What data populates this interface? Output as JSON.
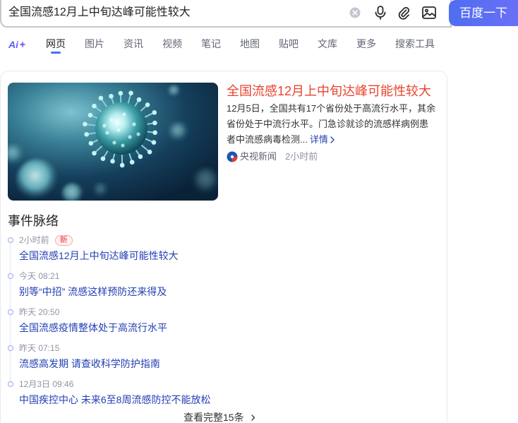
{
  "search": {
    "query": "全国流感12月上中旬达峰可能性较大",
    "button_label": "百度一下",
    "icons": [
      "clear-icon",
      "microphone-icon",
      "paperclip-icon",
      "image-search-icon"
    ]
  },
  "tabs": {
    "ai_logo": "Ai",
    "items": [
      {
        "label": "网页",
        "active": true
      },
      {
        "label": "图片"
      },
      {
        "label": "资讯"
      },
      {
        "label": "视频"
      },
      {
        "label": "笔记"
      },
      {
        "label": "地图"
      },
      {
        "label": "贴吧"
      },
      {
        "label": "文库"
      },
      {
        "label": "更多"
      },
      {
        "label": "搜索工具"
      }
    ]
  },
  "news": {
    "title": "全国流感12月上中旬达峰可能性较大",
    "description": "12月5日，全国共有17个省份处于高流行水平，其余省份处于中流行水平。门急诊就诊的流感样病例患者中流感病毒检测...",
    "detail_link": "详情",
    "source": "央视新闻",
    "time": "2小时前",
    "thumbnail_icon": "virus-photo",
    "source_icon": "cctv-news-logo"
  },
  "timeline": {
    "heading": "事件脉络",
    "items": [
      {
        "time": "2小时前",
        "badge": "新",
        "title": "全国流感12月上中旬达峰可能性较大"
      },
      {
        "time": "今天 08:21",
        "title": "别等“中招” 流感这样预防还来得及"
      },
      {
        "time": "昨天 20:50",
        "title": "全国流感疫情整体处于高流行水平"
      },
      {
        "time": "昨天 07:15",
        "title": "流感高发期 请查收科学防护指南"
      },
      {
        "time": "12月3日 09:46",
        "title": "中国疾控中心 未来6至8周流感防控不能放松"
      }
    ],
    "more_label": "查看完整15条"
  },
  "colors": {
    "accent": "#4e6ef2",
    "accent2": "#6a6ff6",
    "title_red": "#e8432e",
    "link_blue": "#2440b3",
    "badge_red": "#f73131"
  }
}
